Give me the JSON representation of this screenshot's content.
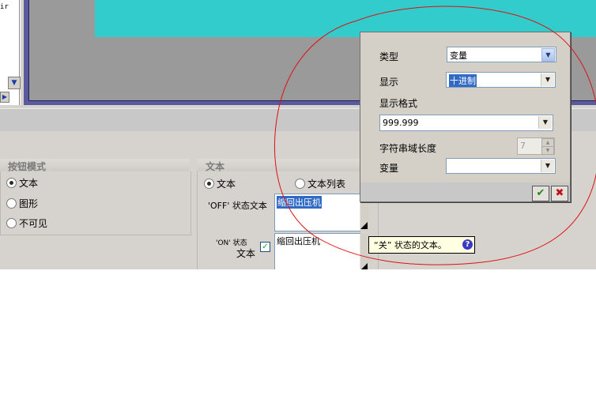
{
  "left_pane": {
    "fragment_text": "ir"
  },
  "button_mode": {
    "title": "按钮模式",
    "options": [
      "文本",
      "图形",
      "不可见"
    ],
    "selected_index": 0
  },
  "text_group": {
    "title": "文本",
    "radio_text": "文本",
    "radio_text_list": "文本列表",
    "off_label": "'OFF' 状态文本",
    "off_value": "缩回出压机",
    "on_label_line1": "'ON' 状态",
    "on_label_line2": "文本",
    "on_checked": true,
    "on_value": "缩回出压机"
  },
  "tooltip": {
    "text": "“关” 状态的文本。",
    "icon": "help-icon"
  },
  "popup": {
    "type_label": "类型",
    "type_value": "变量",
    "display_label": "显示",
    "display_value": "十进制",
    "format_label": "显示格式",
    "format_value": "999.999",
    "length_label": "字符串域长度",
    "length_value": "7",
    "variable_label": "变量",
    "variable_value": "",
    "ok_icon": "check-icon",
    "cancel_icon": "close-icon"
  },
  "colors": {
    "canvas_teal": "#33cccc",
    "canvas_frame": "#5a5a9c",
    "annotation_red": "#dd1111"
  }
}
